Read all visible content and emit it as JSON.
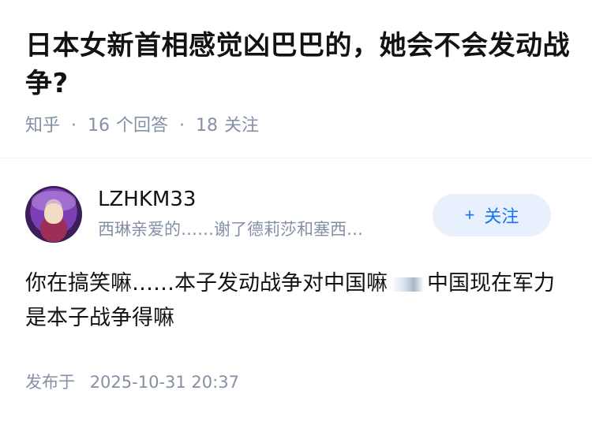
{
  "question": {
    "title": "日本女新首相感觉凶巴巴的，她会不会发动战争?",
    "source": "知乎",
    "separator": "·",
    "answer_count": "16",
    "answer_label": "个回答",
    "follower_count": "18",
    "follower_label": "关注"
  },
  "author": {
    "name": "LZHKM33",
    "bio": "西琳亲爱的……谢了德莉莎和塞西…",
    "follow_label": "关注",
    "follow_icon": "plus-icon"
  },
  "answer": {
    "text_part1": "你在搞笑嘛……本子发动战争对中国嘛",
    "emoji": "sticker-emoji",
    "text_part2": "中国现在军力是本子战争得嘛",
    "time_label": "发布于",
    "time": "2025-10-31 20:37"
  },
  "colors": {
    "title": "#121212",
    "meta": "#8590a6",
    "follow_bg": "#e7f0fc",
    "follow_text": "#1772f6"
  }
}
